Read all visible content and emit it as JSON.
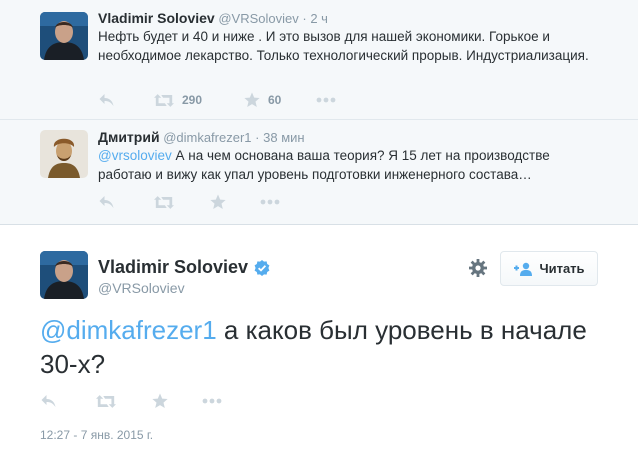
{
  "tweets": [
    {
      "fullname": "Vladimir Soloviev",
      "username": "@VRSoloviev",
      "separator": "·",
      "time": "2 ч",
      "text": "Нефть будет и 40 и ниже . И это вызов для нашей экономики. Горькое и необходимое лекарство. Только технологический прорыв. Индустриализация.",
      "retweets": "290",
      "favorites": "60"
    },
    {
      "fullname": "Дмитрий",
      "username": "@dimkafrezer1",
      "separator": "·",
      "time": "38 мин",
      "mention": "@vrsoloviev",
      "text": " А на чем основана ваша теория? Я 15 лет на производстве работаю и вижу как упал уровень подготовки инженерного состава…"
    }
  ],
  "main_tweet": {
    "fullname": "Vladimir Soloviev",
    "username": "@VRSoloviev",
    "follow_label": "Читать",
    "mention": "@dimkafrezer1",
    "text": " а каков был уровень в начале 30-х?",
    "timestamp": "12:27 - 7 янв. 2015 г."
  },
  "colors": {
    "link": "#55acee",
    "muted": "#8899a6",
    "icon": "#ccd6dd",
    "ancestor_bg": "#f5f8fa"
  },
  "icons": [
    "reply-icon",
    "retweet-icon",
    "favorite-icon",
    "more-icon",
    "verified-icon",
    "gear-icon",
    "follow-person-icon"
  ]
}
